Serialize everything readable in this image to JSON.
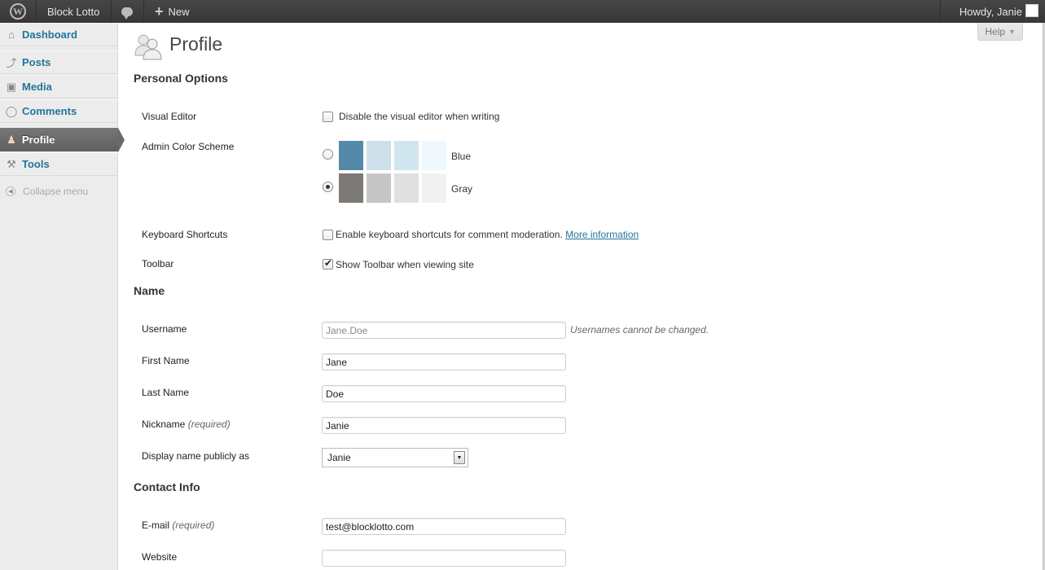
{
  "adminbar": {
    "wp_logo": "W",
    "site_name": "Block Lotto",
    "new_label": "New",
    "howdy": "Howdy, Janie"
  },
  "sidebar": {
    "items": [
      {
        "label": "Dashboard",
        "icon": "house-icon"
      },
      {
        "label": "Posts",
        "icon": "pushpin-icon"
      },
      {
        "label": "Media",
        "icon": "media-icon"
      },
      {
        "label": "Comments",
        "icon": "comment-icon"
      },
      {
        "label": "Profile",
        "icon": "users-icon",
        "current": true
      },
      {
        "label": "Tools",
        "icon": "tools-icon"
      }
    ],
    "collapse_label": "Collapse menu"
  },
  "help": {
    "label": "Help"
  },
  "page": {
    "title": "Profile"
  },
  "personal_options": {
    "heading": "Personal Options",
    "visual_editor": {
      "label": "Visual Editor",
      "option": "Disable the visual editor when writing",
      "checked": false
    },
    "color_scheme": {
      "label": "Admin Color Scheme",
      "schemes": [
        {
          "name": "Blue",
          "selected": false,
          "colors": [
            "#5589aa",
            "#cfdfe9",
            "#d1e5ee",
            "#eff8ff"
          ]
        },
        {
          "name": "Gray",
          "selected": true,
          "colors": [
            "#7c7976",
            "#c6c6c6",
            "#e0e0e0",
            "#f1f1f1"
          ]
        }
      ]
    },
    "keyboard_shortcuts": {
      "label": "Keyboard Shortcuts",
      "option": "Enable keyboard shortcuts for comment moderation.",
      "link": "More information",
      "checked": false
    },
    "toolbar": {
      "label": "Toolbar",
      "option": "Show Toolbar when viewing site",
      "checked": true
    }
  },
  "name_section": {
    "heading": "Name",
    "username": {
      "label": "Username",
      "value": "Jane.Doe",
      "description": "Usernames cannot be changed."
    },
    "first_name": {
      "label": "First Name",
      "value": "Jane"
    },
    "last_name": {
      "label": "Last Name",
      "value": "Doe"
    },
    "nickname": {
      "label": "Nickname",
      "required": "(required)",
      "value": "Janie"
    },
    "display_name": {
      "label": "Display name publicly as",
      "value": "Janie"
    }
  },
  "contact_info": {
    "heading": "Contact Info",
    "email": {
      "label": "E-mail",
      "required": "(required)",
      "value": "test@blocklotto.com"
    },
    "website": {
      "label": "Website",
      "value": ""
    }
  }
}
